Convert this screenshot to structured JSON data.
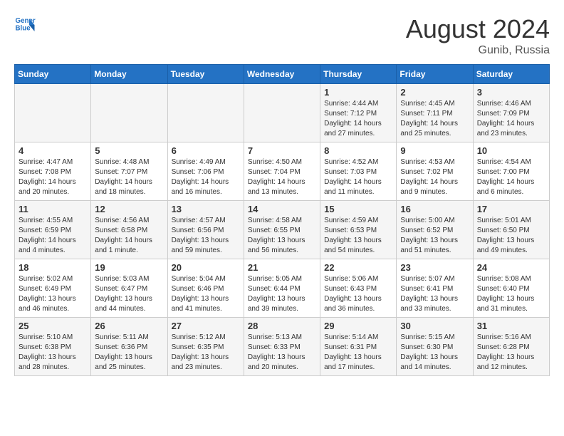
{
  "header": {
    "logo_line1": "General",
    "logo_line2": "Blue",
    "month": "August 2024",
    "location": "Gunib, Russia"
  },
  "days_of_week": [
    "Sunday",
    "Monday",
    "Tuesday",
    "Wednesday",
    "Thursday",
    "Friday",
    "Saturday"
  ],
  "weeks": [
    [
      {
        "day": "",
        "info": ""
      },
      {
        "day": "",
        "info": ""
      },
      {
        "day": "",
        "info": ""
      },
      {
        "day": "",
        "info": ""
      },
      {
        "day": "1",
        "info": "Sunrise: 4:44 AM\nSunset: 7:12 PM\nDaylight: 14 hours\nand 27 minutes."
      },
      {
        "day": "2",
        "info": "Sunrise: 4:45 AM\nSunset: 7:11 PM\nDaylight: 14 hours\nand 25 minutes."
      },
      {
        "day": "3",
        "info": "Sunrise: 4:46 AM\nSunset: 7:09 PM\nDaylight: 14 hours\nand 23 minutes."
      }
    ],
    [
      {
        "day": "4",
        "info": "Sunrise: 4:47 AM\nSunset: 7:08 PM\nDaylight: 14 hours\nand 20 minutes."
      },
      {
        "day": "5",
        "info": "Sunrise: 4:48 AM\nSunset: 7:07 PM\nDaylight: 14 hours\nand 18 minutes."
      },
      {
        "day": "6",
        "info": "Sunrise: 4:49 AM\nSunset: 7:06 PM\nDaylight: 14 hours\nand 16 minutes."
      },
      {
        "day": "7",
        "info": "Sunrise: 4:50 AM\nSunset: 7:04 PM\nDaylight: 14 hours\nand 13 minutes."
      },
      {
        "day": "8",
        "info": "Sunrise: 4:52 AM\nSunset: 7:03 PM\nDaylight: 14 hours\nand 11 minutes."
      },
      {
        "day": "9",
        "info": "Sunrise: 4:53 AM\nSunset: 7:02 PM\nDaylight: 14 hours\nand 9 minutes."
      },
      {
        "day": "10",
        "info": "Sunrise: 4:54 AM\nSunset: 7:00 PM\nDaylight: 14 hours\nand 6 minutes."
      }
    ],
    [
      {
        "day": "11",
        "info": "Sunrise: 4:55 AM\nSunset: 6:59 PM\nDaylight: 14 hours\nand 4 minutes."
      },
      {
        "day": "12",
        "info": "Sunrise: 4:56 AM\nSunset: 6:58 PM\nDaylight: 14 hours\nand 1 minute."
      },
      {
        "day": "13",
        "info": "Sunrise: 4:57 AM\nSunset: 6:56 PM\nDaylight: 13 hours\nand 59 minutes."
      },
      {
        "day": "14",
        "info": "Sunrise: 4:58 AM\nSunset: 6:55 PM\nDaylight: 13 hours\nand 56 minutes."
      },
      {
        "day": "15",
        "info": "Sunrise: 4:59 AM\nSunset: 6:53 PM\nDaylight: 13 hours\nand 54 minutes."
      },
      {
        "day": "16",
        "info": "Sunrise: 5:00 AM\nSunset: 6:52 PM\nDaylight: 13 hours\nand 51 minutes."
      },
      {
        "day": "17",
        "info": "Sunrise: 5:01 AM\nSunset: 6:50 PM\nDaylight: 13 hours\nand 49 minutes."
      }
    ],
    [
      {
        "day": "18",
        "info": "Sunrise: 5:02 AM\nSunset: 6:49 PM\nDaylight: 13 hours\nand 46 minutes."
      },
      {
        "day": "19",
        "info": "Sunrise: 5:03 AM\nSunset: 6:47 PM\nDaylight: 13 hours\nand 44 minutes."
      },
      {
        "day": "20",
        "info": "Sunrise: 5:04 AM\nSunset: 6:46 PM\nDaylight: 13 hours\nand 41 minutes."
      },
      {
        "day": "21",
        "info": "Sunrise: 5:05 AM\nSunset: 6:44 PM\nDaylight: 13 hours\nand 39 minutes."
      },
      {
        "day": "22",
        "info": "Sunrise: 5:06 AM\nSunset: 6:43 PM\nDaylight: 13 hours\nand 36 minutes."
      },
      {
        "day": "23",
        "info": "Sunrise: 5:07 AM\nSunset: 6:41 PM\nDaylight: 13 hours\nand 33 minutes."
      },
      {
        "day": "24",
        "info": "Sunrise: 5:08 AM\nSunset: 6:40 PM\nDaylight: 13 hours\nand 31 minutes."
      }
    ],
    [
      {
        "day": "25",
        "info": "Sunrise: 5:10 AM\nSunset: 6:38 PM\nDaylight: 13 hours\nand 28 minutes."
      },
      {
        "day": "26",
        "info": "Sunrise: 5:11 AM\nSunset: 6:36 PM\nDaylight: 13 hours\nand 25 minutes."
      },
      {
        "day": "27",
        "info": "Sunrise: 5:12 AM\nSunset: 6:35 PM\nDaylight: 13 hours\nand 23 minutes."
      },
      {
        "day": "28",
        "info": "Sunrise: 5:13 AM\nSunset: 6:33 PM\nDaylight: 13 hours\nand 20 minutes."
      },
      {
        "day": "29",
        "info": "Sunrise: 5:14 AM\nSunset: 6:31 PM\nDaylight: 13 hours\nand 17 minutes."
      },
      {
        "day": "30",
        "info": "Sunrise: 5:15 AM\nSunset: 6:30 PM\nDaylight: 13 hours\nand 14 minutes."
      },
      {
        "day": "31",
        "info": "Sunrise: 5:16 AM\nSunset: 6:28 PM\nDaylight: 13 hours\nand 12 minutes."
      }
    ]
  ]
}
